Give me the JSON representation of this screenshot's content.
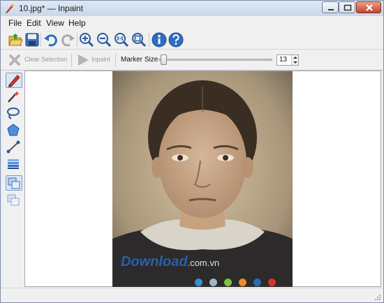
{
  "window": {
    "title": "10.jpg* — Inpaint"
  },
  "menu": [
    "File",
    "Edit",
    "View",
    "Help"
  ],
  "toolbar_icons": [
    "open-icon",
    "save-icon",
    "undo-icon",
    "redo-icon",
    "zoom-in-icon",
    "zoom-out-icon",
    "zoom-actual-icon",
    "zoom-fit-icon",
    "info-icon",
    "help-icon"
  ],
  "options": {
    "clear_selection": "Clear Selection",
    "inpaint": "Inpaint",
    "marker_size_label": "Marker Size",
    "marker_size_value": "13",
    "marker_size_fraction": 0.02
  },
  "tools": [
    "marker-icon",
    "magic-wand-icon",
    "lasso-icon",
    "polygon-icon",
    "line-icon",
    "layers-icon",
    "donor-area-icon",
    "copy-area-icon"
  ],
  "image": {
    "watermark": "Download",
    "watermark_domain": ".com.vn",
    "dot_colors": [
      "#2f8fd6",
      "#9fb7c9",
      "#7cc242",
      "#f08a24",
      "#2a6cb3",
      "#d8332b"
    ]
  }
}
